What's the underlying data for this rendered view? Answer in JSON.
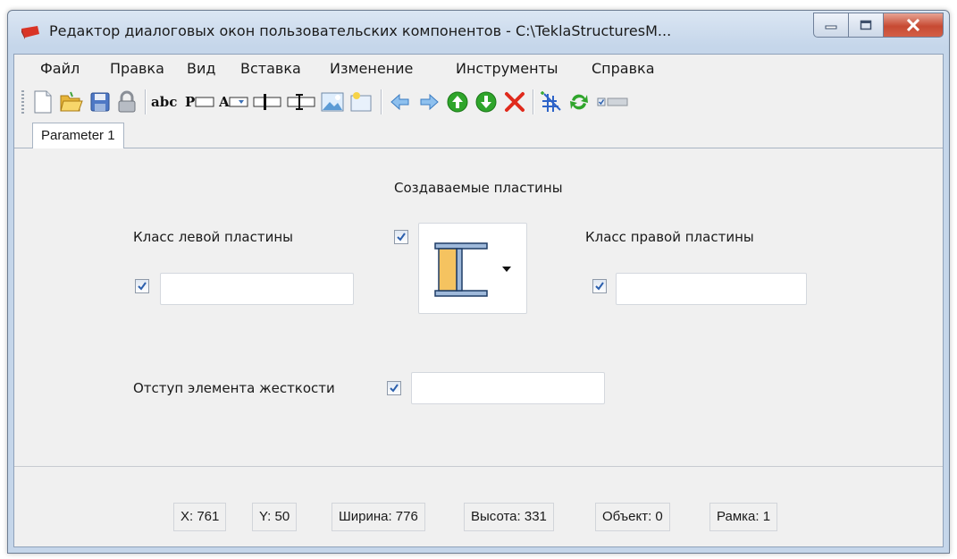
{
  "window": {
    "title": "Редактор диалоговых окон пользовательских компонентов - C:\\TeklaStructuresM..."
  },
  "menu": [
    "Файл",
    "Правка",
    "Вид",
    "Вставка",
    "Изменение",
    "Инструменты",
    "Справка"
  ],
  "toolbar": {
    "icons": [
      "new-file-icon",
      "open-folder-icon",
      "save-icon",
      "lock-icon",
      "text-abc-icon",
      "parameter-field-icon",
      "attribute-dropdown-icon",
      "value-field-icon",
      "image-field-icon",
      "picture-icon",
      "image-list-icon",
      "arrow-left-icon",
      "arrow-right-icon",
      "arrow-up-icon",
      "arrow-down-icon",
      "delete-icon",
      "grid-icon",
      "refresh-icon",
      "toggle-checkbox-icon"
    ]
  },
  "tabs": [
    {
      "label": "Parameter 1",
      "active": true
    }
  ],
  "form": {
    "heading": "Создаваемые пластины",
    "left_plate_label": "Класс левой пластины",
    "left_plate_value": "",
    "left_plate_checked": true,
    "right_plate_label": "Класс правой пластины",
    "right_plate_value": "",
    "right_plate_checked": true,
    "picture_checked": true,
    "offset_label": "Отступ элемента жесткости",
    "offset_value": "",
    "offset_checked": true
  },
  "status": {
    "x": "X: 761",
    "y": "Y: 50",
    "width": "Ширина: 776",
    "height": "Высота: 331",
    "object": "Объект: 0",
    "frame": "Рамка: 1"
  },
  "colors": {
    "accent": "#3b6fb6",
    "plate_fill": "#f5c360",
    "close_button": "#c74a33"
  }
}
